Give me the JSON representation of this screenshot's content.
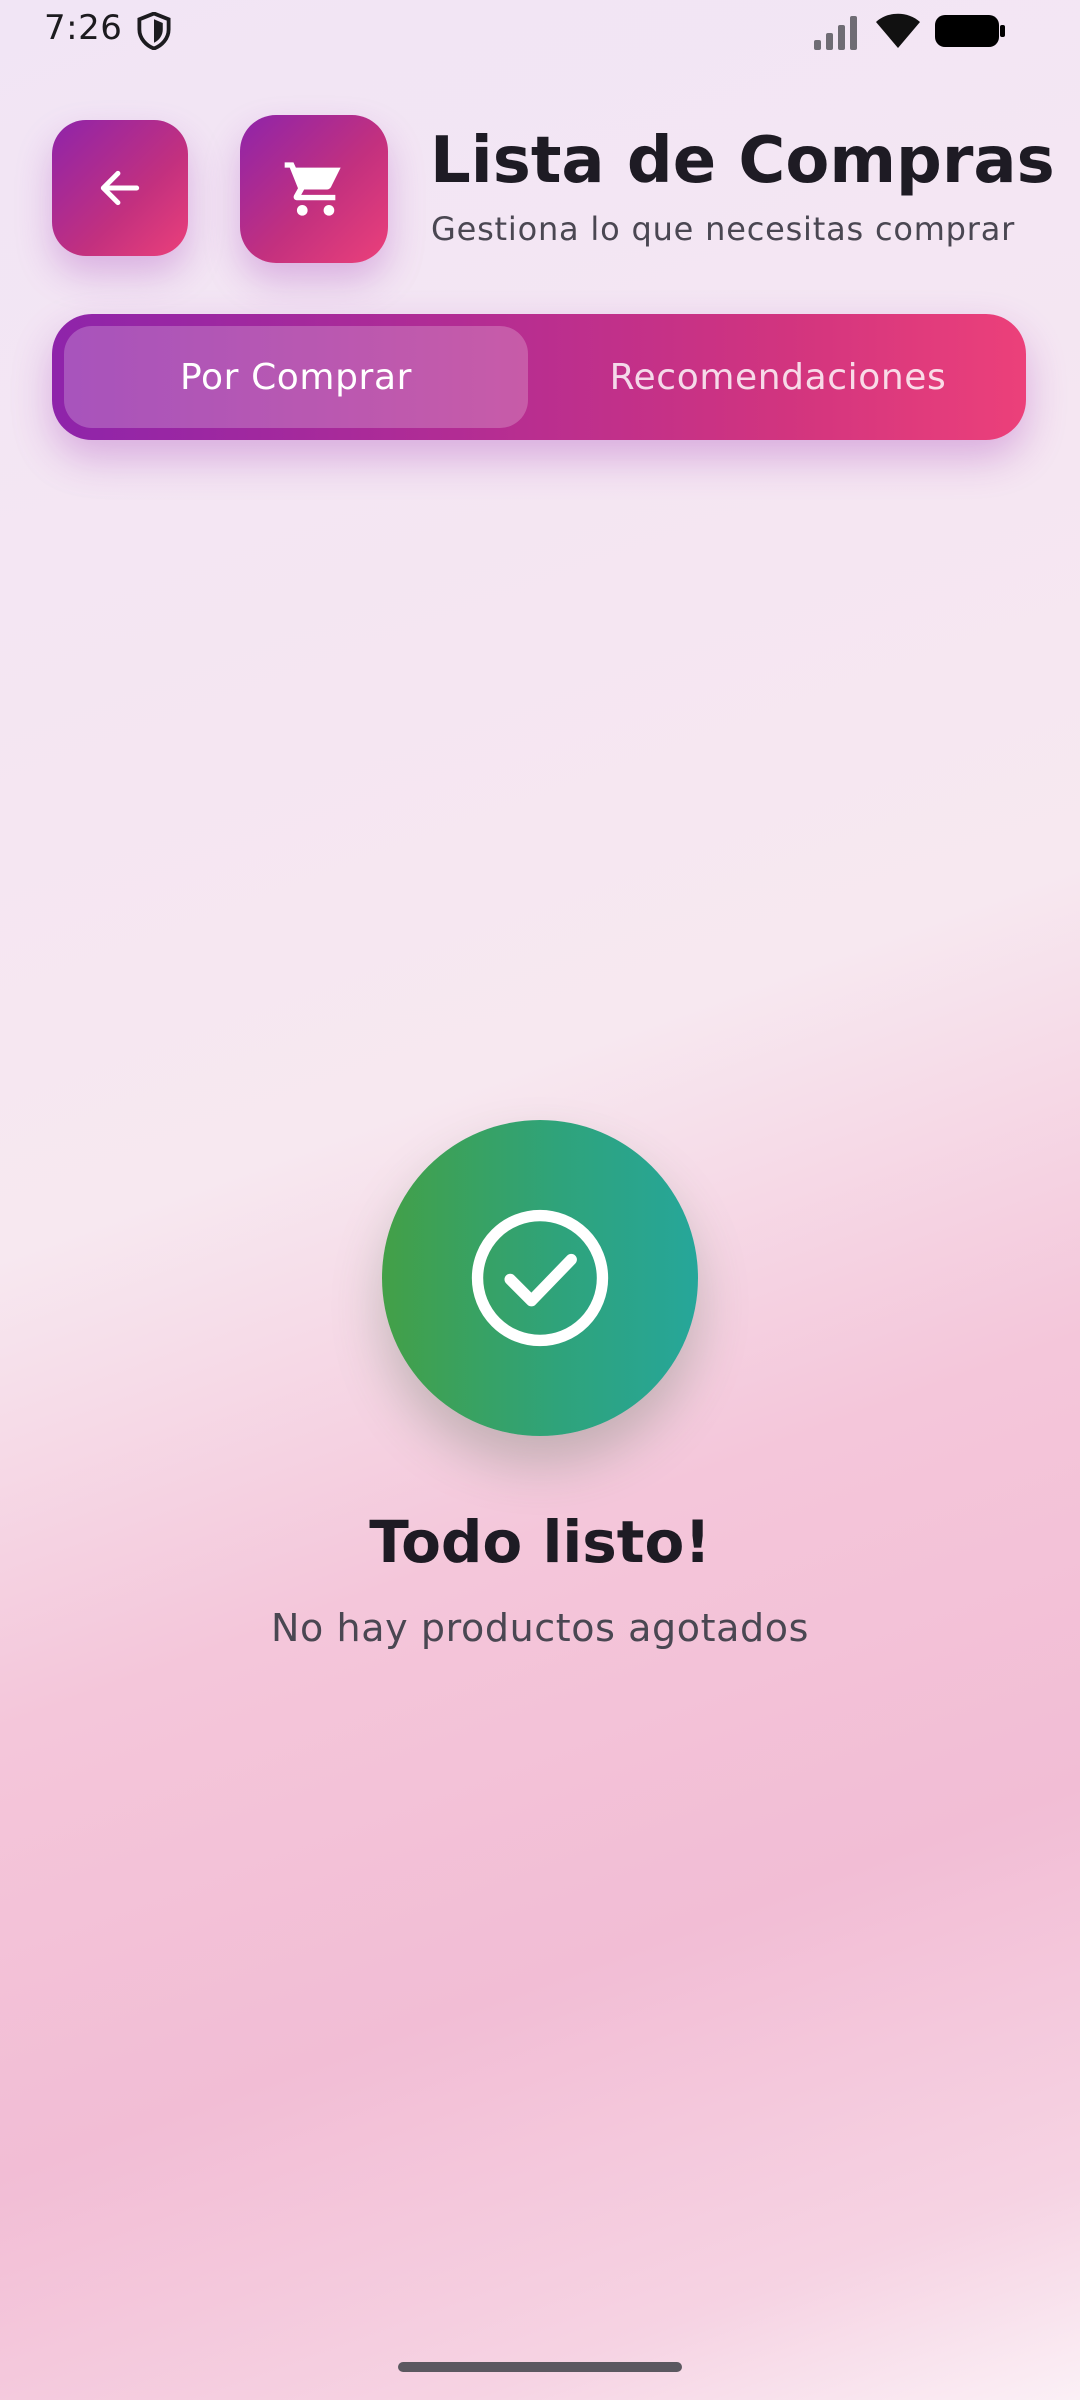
{
  "status_bar": {
    "time": "7:26",
    "icons": [
      "shield-icon",
      "signal-icon",
      "wifi-icon",
      "battery-icon"
    ]
  },
  "header": {
    "back_icon": "arrow-left-icon",
    "badge_icon": "shopping-cart-icon",
    "title": "Lista de Compras",
    "subtitle": "Gestiona lo que necesitas comprar"
  },
  "tabs": [
    {
      "label": "Por Comprar",
      "selected": true
    },
    {
      "label": "Recomendaciones",
      "selected": false
    }
  ],
  "empty_state": {
    "icon": "check-circle-icon",
    "title": "Todo listo!",
    "message": "No hay productos agotados"
  },
  "colors": {
    "accent_start": "#8e24aa",
    "accent_end": "#ec407a",
    "success_start": "#43a047",
    "success_end": "#26a69a",
    "text_primary": "#1e1b24",
    "text_secondary": "#4a4752"
  }
}
